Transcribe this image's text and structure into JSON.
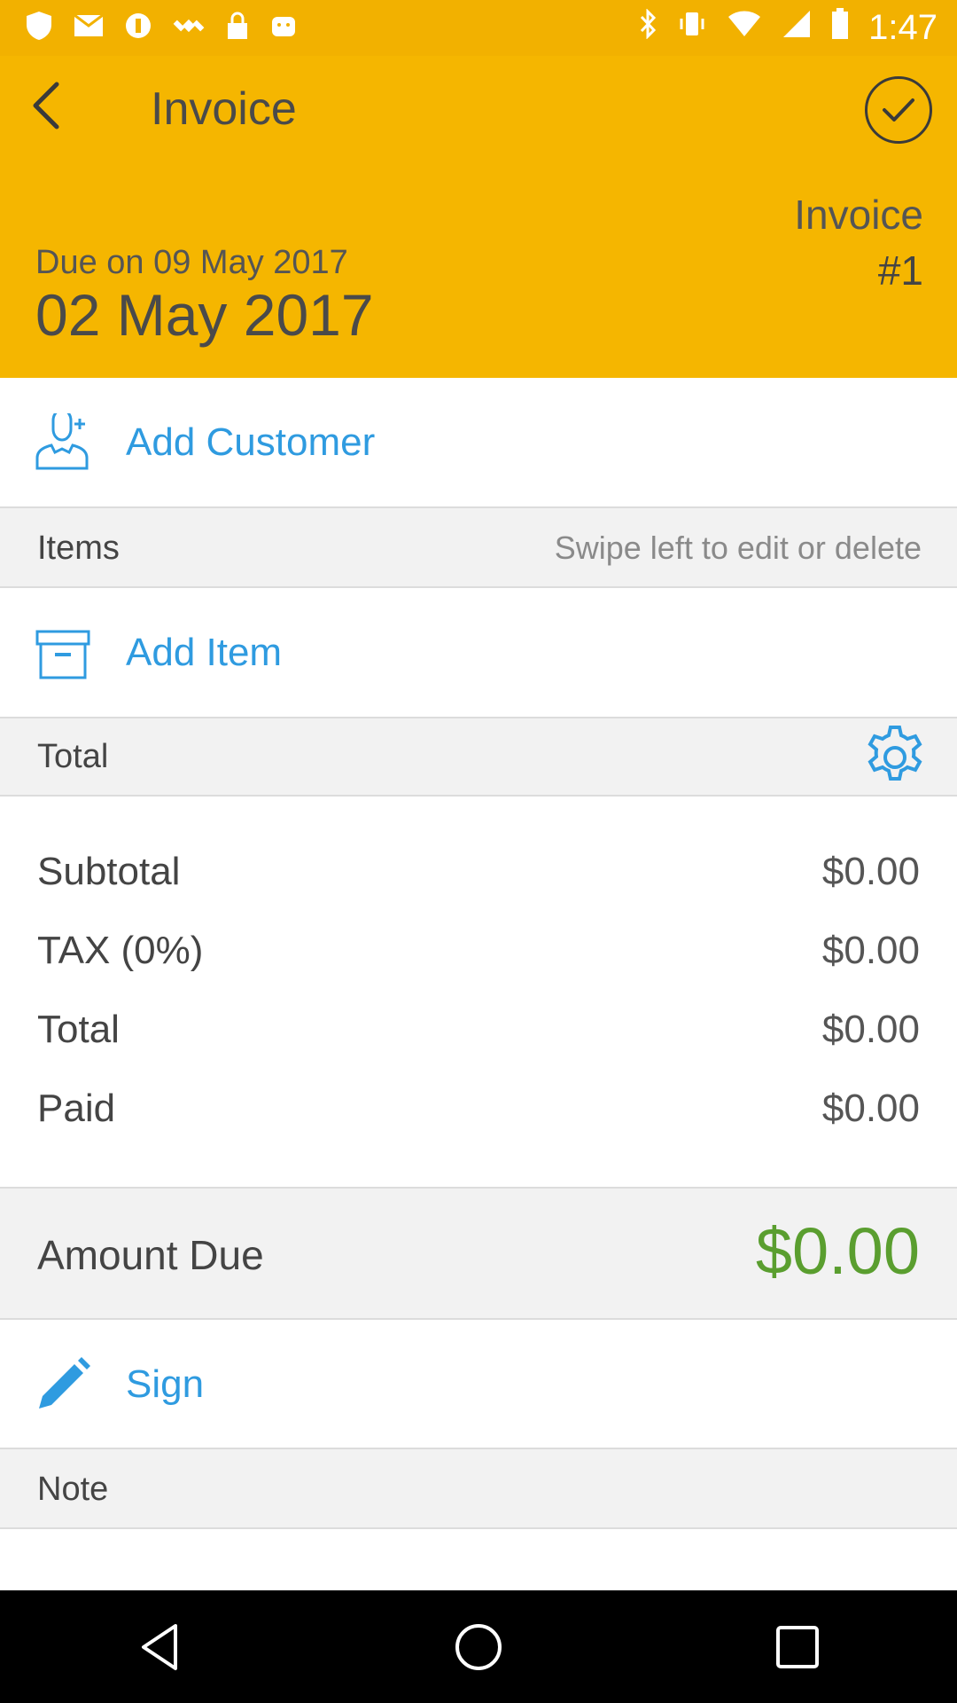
{
  "status_bar": {
    "time": "1:47",
    "left_icons": [
      "shield-icon",
      "mail-icon",
      "coin-icon",
      "satellite-icon",
      "lock-icon",
      "android-icon"
    ],
    "right_icons": [
      "bluetooth-icon",
      "vibrate-icon",
      "wifi-icon",
      "signal-icon",
      "battery-icon"
    ]
  },
  "header": {
    "title": "Invoice",
    "invoice_label": "Invoice",
    "invoice_number": "#1",
    "due_text": "Due on 09 May 2017",
    "date": "02 May 2017",
    "accent_color": "#f5b600"
  },
  "customer": {
    "label": "Add Customer"
  },
  "items": {
    "title": "Items",
    "hint": "Swipe left to edit or delete"
  },
  "add_item": {
    "label": "Add Item"
  },
  "total_section": {
    "title": "Total"
  },
  "summary": [
    {
      "label": "Subtotal",
      "value": "$0.00"
    },
    {
      "label": "TAX (0%)",
      "value": "$0.00"
    },
    {
      "label": "Total",
      "value": "$0.00"
    },
    {
      "label": "Paid",
      "value": "$0.00"
    }
  ],
  "amount_due": {
    "label": "Amount Due",
    "value": "$0.00",
    "color": "#5a9e2f"
  },
  "sign": {
    "label": "Sign"
  },
  "note": {
    "title": "Note"
  },
  "link_color": "#2f9be0"
}
